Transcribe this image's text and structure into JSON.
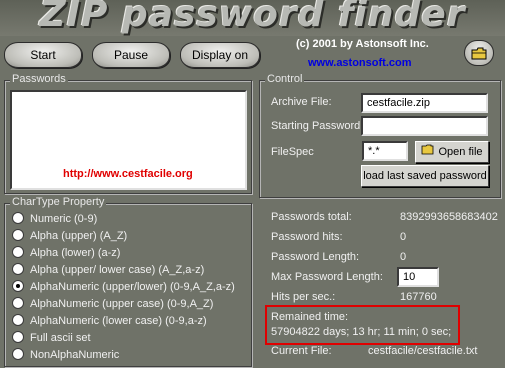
{
  "app": {
    "title": "ZIP password finder",
    "copyright": "(c) 2001 by Astonsoft Inc.",
    "website": "www.astonsoft.com"
  },
  "toolbar": {
    "start_label": "Start",
    "pause_label": "Pause",
    "display_label": "Display on",
    "open_icon": "folder-icon"
  },
  "passwords": {
    "title": "Passwords",
    "url": "http://www.cestfacile.org"
  },
  "chartype": {
    "title": "CharType Property",
    "options": [
      {
        "label": "Numeric (0-9)",
        "checked": false
      },
      {
        "label": "Alpha (upper) (A_Z)",
        "checked": false
      },
      {
        "label": "Alpha (lower) (a-z)",
        "checked": false
      },
      {
        "label": "Alpha (upper/ lower case) (A_Z,a-z)",
        "checked": false
      },
      {
        "label": "AlphaNumeric (upper/lower) (0-9,A_Z,a-z)",
        "checked": true
      },
      {
        "label": "AlphaNumeric (upper case) (0-9,A_Z)",
        "checked": false
      },
      {
        "label": "AlphaNumeric (lower case) (0-9,a-z)",
        "checked": false
      },
      {
        "label": "Full ascii set",
        "checked": false
      },
      {
        "label": "NonAlphaNumeric",
        "checked": false
      }
    ]
  },
  "control": {
    "title": "Control",
    "archive_file_label": "Archive File:",
    "archive_file_value": "cestfacile.zip",
    "starting_password_label": "Starting Password:",
    "starting_password_value": "",
    "filespec_label": "FileSpec",
    "filespec_value": "*.*",
    "open_file_label": "Open file",
    "load_saved_label": "load last saved password"
  },
  "stats": {
    "passwords_total_label": "Passwords total:",
    "passwords_total_value": "8392993658683402",
    "password_hits_label": "Password hits:",
    "password_hits_value": "0",
    "password_length_label": "Password Length:",
    "password_length_value": "0",
    "max_password_length_label": "Max Password Length:",
    "max_password_length_value": "10",
    "hits_per_sec_label": "Hits per sec.:",
    "hits_per_sec_value": "167760",
    "remained_time_label": "Remained time:",
    "remained_time_value": "57904822 days; 13 hr; 11 min; 0 sec;",
    "current_file_label": "Current File:",
    "current_file_value": "cestfacile/cestfacile.txt"
  },
  "colors": {
    "background": "#6f7268",
    "url_red": "#e00000",
    "website_blue": "#0000e0",
    "highlight_red": "#e00000"
  }
}
